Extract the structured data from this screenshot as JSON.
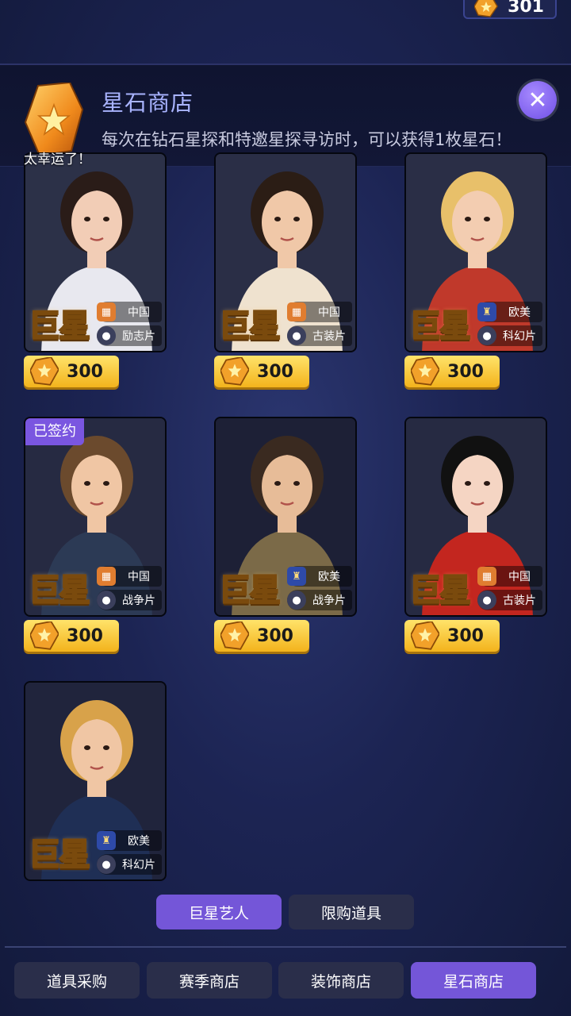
{
  "currency": {
    "amount": "301",
    "icon": "star-stone-icon"
  },
  "header": {
    "title": "星石商店",
    "description": "每次在钻石星探和特邀星探寻访时，可以获得1枚星石！",
    "lucky_text": "太幸运了！",
    "close_icon": "close-icon"
  },
  "cards": [
    {
      "title": "巨星",
      "region": "中国",
      "genre": "励志片",
      "price": "300",
      "signed": "",
      "bg": "#2c3148",
      "skin": "#f2cdb6",
      "hair": "#2a1c18",
      "cloth": "#e8e8ef"
    },
    {
      "title": "巨星",
      "region": "中国",
      "genre": "古装片",
      "price": "300",
      "signed": "",
      "bg": "#2a2e46",
      "skin": "#f0c8a8",
      "hair": "#2b1d15",
      "cloth": "#efe2cf"
    },
    {
      "title": "巨星",
      "region": "欧美",
      "genre": "科幻片",
      "price": "300",
      "signed": "",
      "bg": "#2a2e46",
      "skin": "#f3cdb1",
      "hair": "#e8c06a",
      "cloth": "#c0392b"
    },
    {
      "title": "巨星",
      "region": "中国",
      "genre": "战争片",
      "price": "300",
      "signed": "已签约",
      "bg": "#262a42",
      "skin": "#f0c6a4",
      "hair": "#6b4a2d",
      "cloth": "#2c3a55"
    },
    {
      "title": "巨星",
      "region": "欧美",
      "genre": "战争片",
      "price": "300",
      "signed": "",
      "bg": "#1d2036",
      "skin": "#e7bc98",
      "hair": "#3a2a20",
      "cloth": "#7b6a48"
    },
    {
      "title": "巨星",
      "region": "中国",
      "genre": "古装片",
      "price": "300",
      "signed": "",
      "bg": "#262a42",
      "skin": "#f5d5c3",
      "hair": "#111111",
      "cloth": "#c3261f"
    },
    {
      "title": "巨星",
      "region": "欧美",
      "genre": "科幻片",
      "price": "",
      "signed": "",
      "bg": "#20243c",
      "skin": "#f0c6a4",
      "hair": "#d8a24a",
      "cloth": "#1f2f55"
    }
  ],
  "sub_tabs": [
    {
      "label": "巨星艺人",
      "active": true
    },
    {
      "label": "限购道具",
      "active": false
    }
  ],
  "main_tabs": [
    {
      "label": "道具采购",
      "active": false
    },
    {
      "label": "赛季商店",
      "active": false
    },
    {
      "label": "装饰商店",
      "active": false
    },
    {
      "label": "星石商店",
      "active": true
    }
  ]
}
